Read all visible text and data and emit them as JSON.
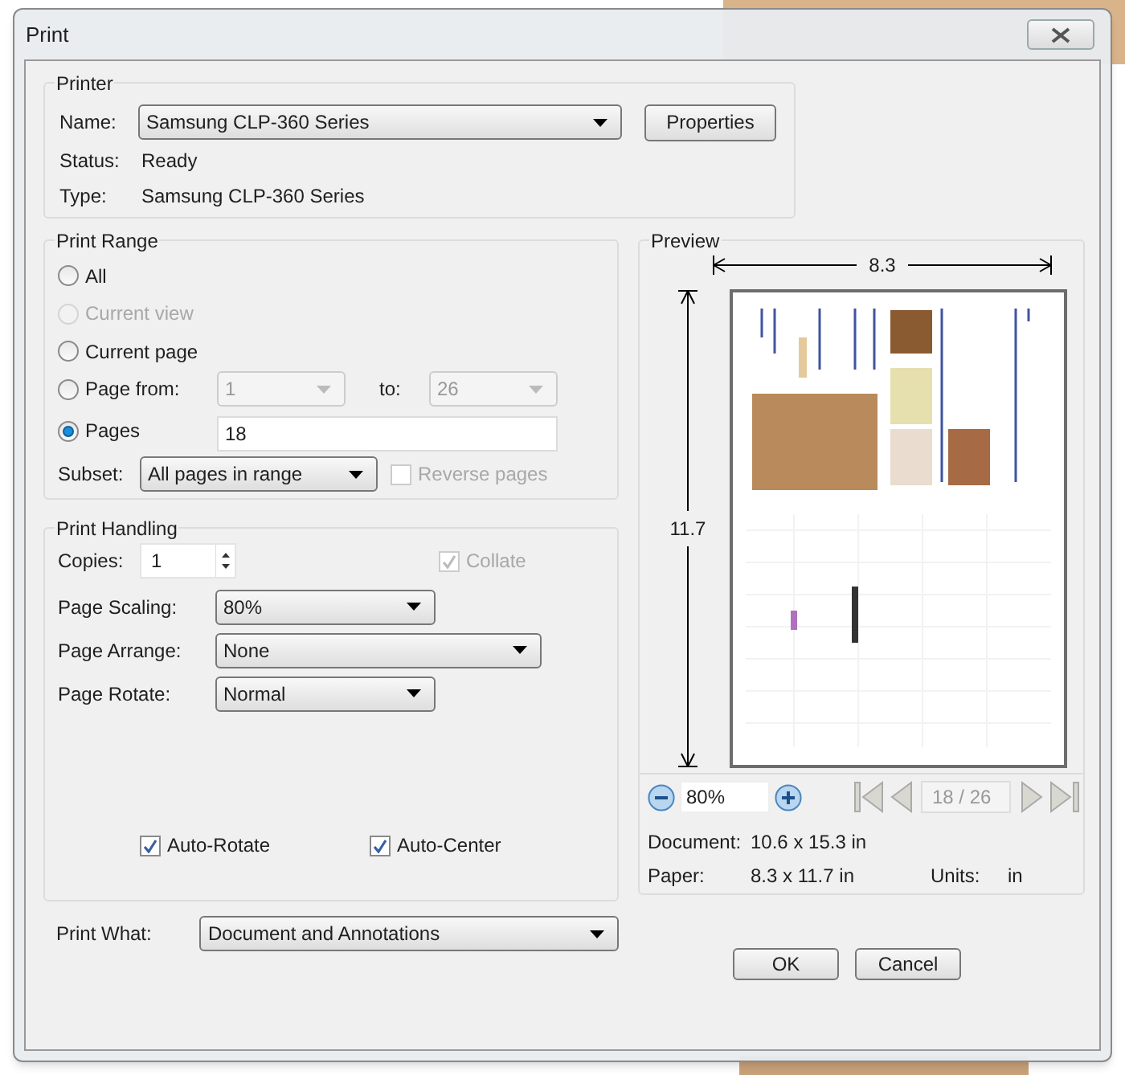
{
  "window": {
    "title": "Print"
  },
  "printer": {
    "legend": "Printer",
    "name_label": "Name:",
    "name_value": "Samsung CLP-360 Series",
    "properties_button": "Properties",
    "status_label": "Status:",
    "status_value": "Ready",
    "type_label": "Type:",
    "type_value": "Samsung CLP-360 Series"
  },
  "print_range": {
    "legend": "Print Range",
    "options": [
      {
        "kind": "plain",
        "label": "All",
        "selected": false,
        "disabled": false
      },
      {
        "kind": "plain",
        "label": "Current view",
        "selected": false,
        "disabled": true
      },
      {
        "kind": "plain",
        "label": "Current page",
        "selected": false,
        "disabled": false
      },
      {
        "kind": "range",
        "label": "Page from:",
        "selected": false,
        "disabled": false,
        "from_value": "1",
        "to_label": "to:",
        "to_value": "26"
      },
      {
        "kind": "pages",
        "label": "Pages",
        "selected": true,
        "disabled": false,
        "value": "18"
      }
    ],
    "subset_label": "Subset:",
    "subset_value": "All pages in range",
    "reverse_pages": {
      "label": "Reverse pages",
      "checked": false,
      "disabled": true
    }
  },
  "print_handling": {
    "legend": "Print Handling",
    "copies_label": "Copies:",
    "copies_value": "1",
    "collate": {
      "label": "Collate",
      "checked": true,
      "disabled": true
    },
    "selects": [
      {
        "label": "Page Scaling:",
        "value": "80%"
      },
      {
        "label": "Page Arrange:",
        "value": "None"
      },
      {
        "label": "Page Rotate:",
        "value": "Normal"
      }
    ],
    "checkboxes": [
      {
        "label": "Auto-Rotate",
        "checked": true
      },
      {
        "label": "Auto-Center",
        "checked": true
      }
    ]
  },
  "print_what": {
    "label": "Print What:",
    "value": "Document and Annotations"
  },
  "preview": {
    "legend": "Preview",
    "width_label": "8.3",
    "height_label": "11.7",
    "zoom_value": "80%",
    "page_value": "18 / 26",
    "document_label": "Document:",
    "document_value": "10.6 x 15.3 in",
    "paper_label": "Paper:",
    "paper_value": "8.3 x 11.7 in",
    "units_label": "Units:",
    "units_value": "in"
  },
  "buttons": [
    "OK",
    "Cancel"
  ]
}
